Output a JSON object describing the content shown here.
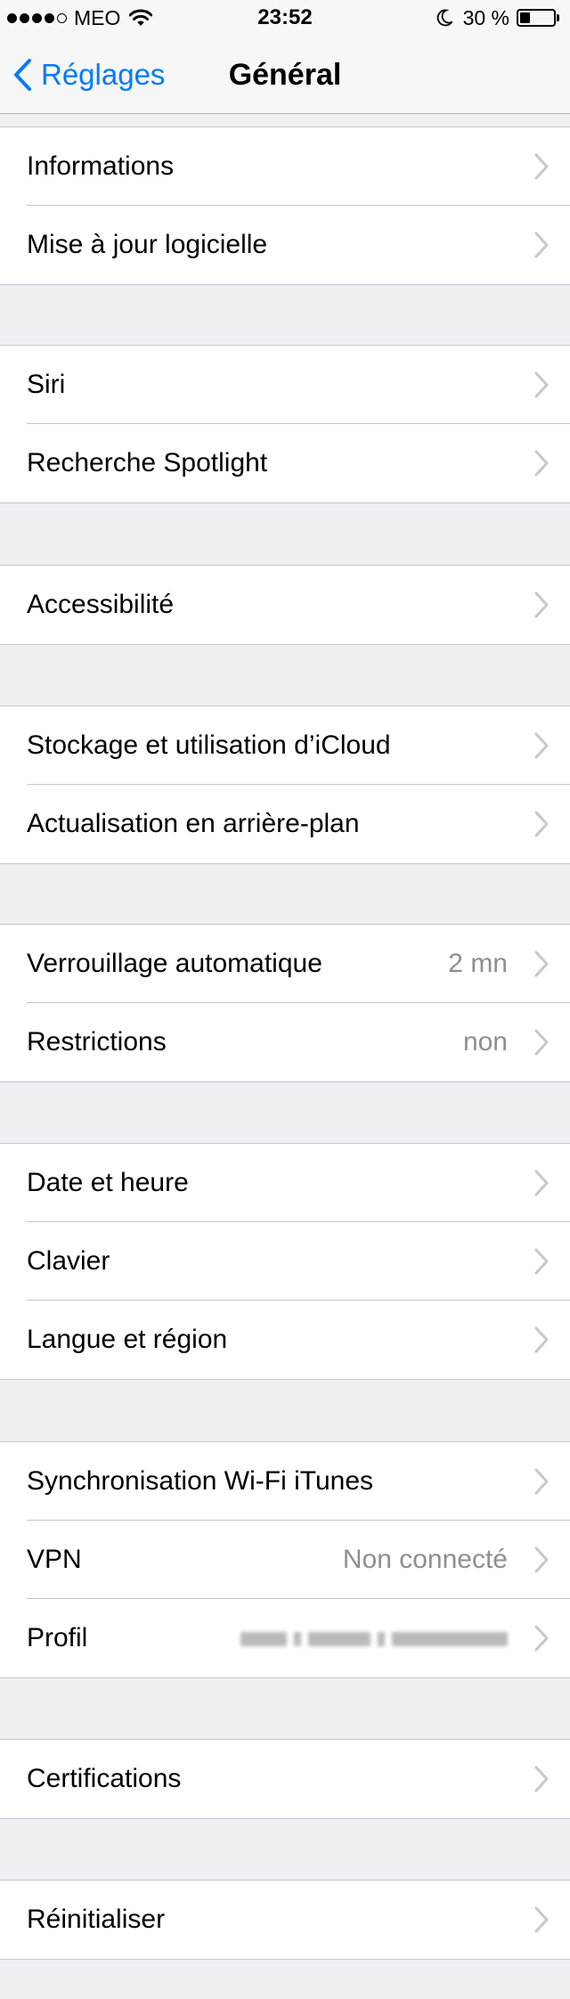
{
  "status_bar": {
    "carrier": "MEO",
    "time": "23:52",
    "battery_percent": "30 %",
    "battery_level": 0.3,
    "signal_bars_filled": 4,
    "signal_bars_total": 5,
    "icons": [
      "signal-dots-icon",
      "wifi-icon",
      "moon-icon",
      "battery-icon"
    ]
  },
  "nav": {
    "back_label": "Réglages",
    "title": "Général",
    "accent_color": "#007aff"
  },
  "sections": [
    {
      "rows": [
        {
          "label": "Informations"
        },
        {
          "label": "Mise à jour logicielle"
        }
      ]
    },
    {
      "rows": [
        {
          "label": "Siri"
        },
        {
          "label": "Recherche Spotlight"
        }
      ]
    },
    {
      "rows": [
        {
          "label": "Accessibilité"
        }
      ]
    },
    {
      "rows": [
        {
          "label": "Stockage et utilisation d’iCloud"
        },
        {
          "label": "Actualisation en arrière-plan"
        }
      ]
    },
    {
      "rows": [
        {
          "label": "Verrouillage automatique",
          "value": "2 mn"
        },
        {
          "label": "Restrictions",
          "value": "non"
        }
      ]
    },
    {
      "rows": [
        {
          "label": "Date et heure"
        },
        {
          "label": "Clavier"
        },
        {
          "label": "Langue et région"
        }
      ]
    },
    {
      "rows": [
        {
          "label": "Synchronisation Wi-Fi iTunes"
        },
        {
          "label": "VPN",
          "value": "Non connecté"
        },
        {
          "label": "Profil",
          "value": "",
          "value_obscured": true
        }
      ]
    },
    {
      "rows": [
        {
          "label": "Certifications"
        }
      ]
    },
    {
      "rows": [
        {
          "label": "Réinitialiser"
        }
      ]
    }
  ]
}
